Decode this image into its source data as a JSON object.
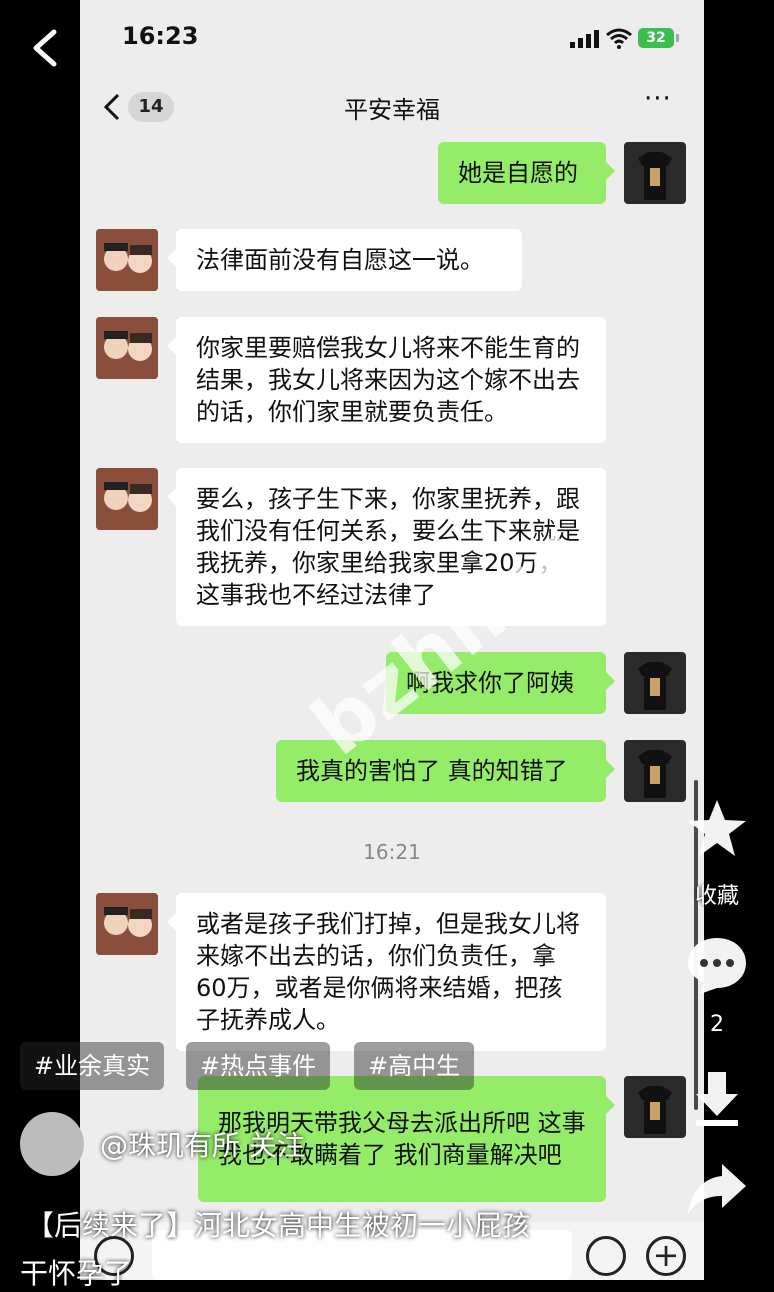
{
  "status_bar": {
    "time": "16:23",
    "battery": "32"
  },
  "chat": {
    "title": "平安幸福",
    "unread_count": "14",
    "more": "···"
  },
  "messages": [
    {
      "side": "out",
      "text": "她是自愿的"
    },
    {
      "side": "in",
      "text": "法律面前没有自愿这一说。"
    },
    {
      "side": "in",
      "text": "你家里要赔偿我女儿将来不能生育的结果，我女儿将来因为这个嫁不出去的话，你们家里就要负责任。"
    },
    {
      "side": "in",
      "text": "要么，孩子生下来，你家里抚养，跟我们没有任何关系，要么生下来就是我抚养，你家里给我家里拿20万，这事我也不经过法律了"
    },
    {
      "side": "out",
      "text": "啊我求你了阿姨"
    },
    {
      "side": "out",
      "text": "我真的害怕了 真的知错了"
    },
    {
      "side": "in",
      "text": "或者是孩子我们打掉，但是我女儿将来嫁不出去的话，你们负责任，拿60万，或者是你俩将来结婚，把孩子抚养成人。"
    },
    {
      "side": "out",
      "text": "那我明天带我父母去派出所吧 这事我也不敢瞒着了 我们商量解决吧"
    }
  ],
  "timestamp": "16:21",
  "watermark": "bzhl.cc",
  "side_actions": {
    "favorite_label": "收藏",
    "comment_count": "2"
  },
  "tags": [
    "#业余真实",
    "#热点事件",
    "#高中生"
  ],
  "author": "@珠玑有所 关注",
  "caption": {
    "line1": "【后续来了】河北女高中生被初一小屁孩",
    "line2": "干怀孕了"
  }
}
